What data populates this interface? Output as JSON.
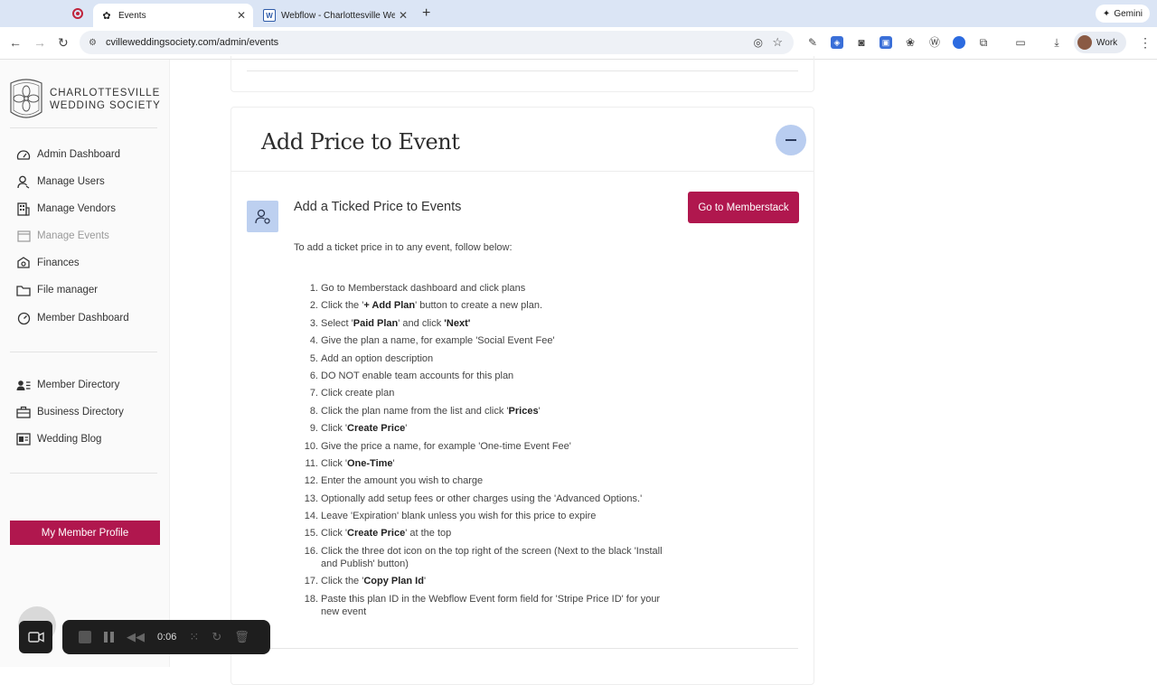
{
  "browser": {
    "tabs": [
      {
        "title": "Events",
        "favicon": "flower-icon",
        "active": true
      },
      {
        "title": "Webflow - Charlottesville We",
        "favicon": "webflow-icon",
        "active": false
      }
    ],
    "new_tab_symbol": "+",
    "gemini_label": "Gemini",
    "url": "cvilleweddingsociety.com/admin/events",
    "profile_label": "Work"
  },
  "sidebar": {
    "brand_line1": "CHARLOTTESVILLE",
    "brand_line2": "WEDDING SOCIETY",
    "admin_items": [
      {
        "label": "Admin Dashboard",
        "icon": "dashboard-icon"
      },
      {
        "label": "Manage Users",
        "icon": "user-icon"
      },
      {
        "label": "Manage Vendors",
        "icon": "building-icon"
      },
      {
        "label": "Manage Events",
        "icon": "calendar-icon",
        "disabled": true
      },
      {
        "label": "Finances",
        "icon": "finance-icon"
      },
      {
        "label": "File manager",
        "icon": "folder-icon"
      },
      {
        "label": "Member Dashboard",
        "icon": "gauge-icon"
      }
    ],
    "directory_items": [
      {
        "label": "Member Directory",
        "icon": "directory-icon"
      },
      {
        "label": "Business Directory",
        "icon": "briefcase-icon"
      },
      {
        "label": "Wedding Blog",
        "icon": "blog-icon"
      }
    ],
    "profile_button": "My Member Profile"
  },
  "main": {
    "card_title": "Add Price to Event",
    "section_title": "Add a Ticked Price to Events",
    "go_button": "Go to Memberstack",
    "intro": "To add a ticket price in to any event, follow below:",
    "steps": [
      {
        "n": "1.",
        "parts": [
          [
            "Go to Memberstack dashboard and click plans",
            false
          ]
        ]
      },
      {
        "n": "2.",
        "parts": [
          [
            "Click the '",
            false
          ],
          [
            "+ Add Plan",
            true
          ],
          [
            "' button to create a new plan.",
            false
          ]
        ]
      },
      {
        "n": "3.",
        "parts": [
          [
            "Select '",
            false
          ],
          [
            "Paid Plan",
            true
          ],
          [
            "' and click ",
            false
          ],
          [
            "'Next'",
            true
          ]
        ]
      },
      {
        "n": "4.",
        "parts": [
          [
            "Give the plan a name, for example 'Social Event Fee'",
            false
          ]
        ]
      },
      {
        "n": "5.",
        "parts": [
          [
            "Add an option description",
            false
          ]
        ]
      },
      {
        "n": "6.",
        "parts": [
          [
            "DO NOT enable team accounts for this plan",
            false
          ]
        ]
      },
      {
        "n": "7.",
        "parts": [
          [
            "Click create plan",
            false
          ]
        ]
      },
      {
        "n": "8.",
        "parts": [
          [
            "Click the plan name from the list and click '",
            false
          ],
          [
            "Prices",
            true
          ],
          [
            "'",
            false
          ]
        ]
      },
      {
        "n": "9.",
        "parts": [
          [
            "Click '",
            false
          ],
          [
            "Create Price",
            true
          ],
          [
            "'",
            false
          ]
        ]
      },
      {
        "n": "10.",
        "parts": [
          [
            "Give the price a name, for example 'One-time Event Fee'",
            false
          ]
        ]
      },
      {
        "n": "11.",
        "parts": [
          [
            "Click '",
            false
          ],
          [
            "One-Time",
            true
          ],
          [
            "'",
            false
          ]
        ]
      },
      {
        "n": "12.",
        "parts": [
          [
            "Enter the amount you wish to charge",
            false
          ]
        ]
      },
      {
        "n": "13.",
        "parts": [
          [
            "Optionally add setup fees or other charges using the 'Advanced Options.'",
            false
          ]
        ]
      },
      {
        "n": "14.",
        "parts": [
          [
            "Leave 'Expiration' blank unless you wish for this price to expire",
            false
          ]
        ]
      },
      {
        "n": "15.",
        "parts": [
          [
            "Click '",
            false
          ],
          [
            "Create Price",
            true
          ],
          [
            "' at the top",
            false
          ]
        ]
      },
      {
        "n": "16.",
        "parts": [
          [
            "Click the three dot icon on the top right of the screen (Next to the black 'Install and Publish' button)",
            false
          ]
        ]
      },
      {
        "n": "17.",
        "parts": [
          [
            "Click the '",
            false
          ],
          [
            "Copy Plan Id",
            true
          ],
          [
            "'",
            false
          ]
        ]
      },
      {
        "n": "18.",
        "parts": [
          [
            "Paste this plan ID in the Webflow Event form field for 'Stripe Price ID' for your new event",
            false
          ]
        ]
      }
    ]
  },
  "recorder": {
    "time": "0:06"
  },
  "colors": {
    "accent": "#b0174e",
    "icon_bg": "#bdd0f0",
    "tabbar": "#dbe5f5"
  }
}
